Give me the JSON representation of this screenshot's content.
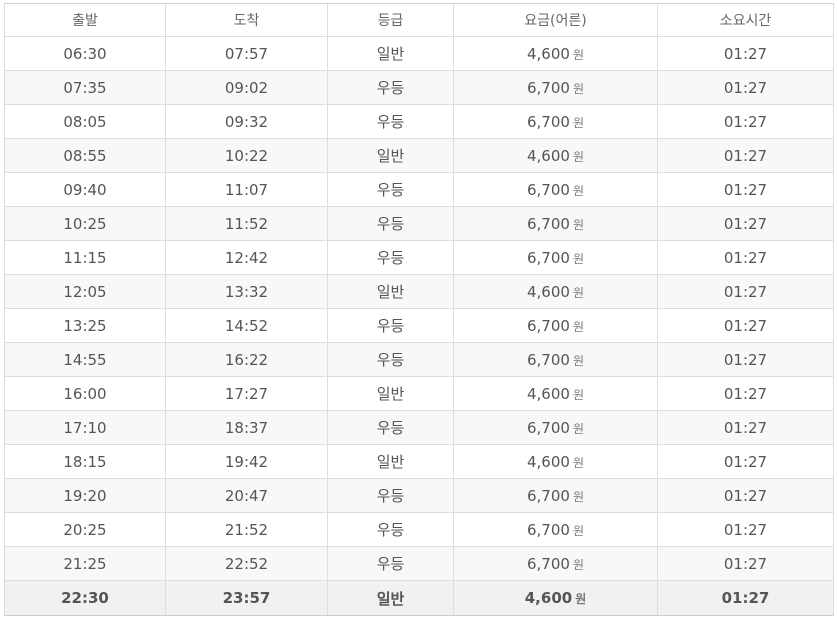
{
  "table": {
    "headers": [
      "출발",
      "도착",
      "등급",
      "요금(어른)",
      "소요시간"
    ],
    "currency_unit": "원",
    "rows": [
      {
        "depart": "06:30",
        "arrive": "07:57",
        "grade": "일반",
        "fare": "4,600",
        "duration": "01:27"
      },
      {
        "depart": "07:35",
        "arrive": "09:02",
        "grade": "우등",
        "fare": "6,700",
        "duration": "01:27"
      },
      {
        "depart": "08:05",
        "arrive": "09:32",
        "grade": "우등",
        "fare": "6,700",
        "duration": "01:27"
      },
      {
        "depart": "08:55",
        "arrive": "10:22",
        "grade": "일반",
        "fare": "4,600",
        "duration": "01:27"
      },
      {
        "depart": "09:40",
        "arrive": "11:07",
        "grade": "우등",
        "fare": "6,700",
        "duration": "01:27"
      },
      {
        "depart": "10:25",
        "arrive": "11:52",
        "grade": "우등",
        "fare": "6,700",
        "duration": "01:27"
      },
      {
        "depart": "11:15",
        "arrive": "12:42",
        "grade": "우등",
        "fare": "6,700",
        "duration": "01:27"
      },
      {
        "depart": "12:05",
        "arrive": "13:32",
        "grade": "일반",
        "fare": "4,600",
        "duration": "01:27"
      },
      {
        "depart": "13:25",
        "arrive": "14:52",
        "grade": "우등",
        "fare": "6,700",
        "duration": "01:27"
      },
      {
        "depart": "14:55",
        "arrive": "16:22",
        "grade": "우등",
        "fare": "6,700",
        "duration": "01:27"
      },
      {
        "depart": "16:00",
        "arrive": "17:27",
        "grade": "일반",
        "fare": "4,600",
        "duration": "01:27"
      },
      {
        "depart": "17:10",
        "arrive": "18:37",
        "grade": "우등",
        "fare": "6,700",
        "duration": "01:27"
      },
      {
        "depart": "18:15",
        "arrive": "19:42",
        "grade": "일반",
        "fare": "4,600",
        "duration": "01:27"
      },
      {
        "depart": "19:20",
        "arrive": "20:47",
        "grade": "우등",
        "fare": "6,700",
        "duration": "01:27"
      },
      {
        "depart": "20:25",
        "arrive": "21:52",
        "grade": "우등",
        "fare": "6,700",
        "duration": "01:27"
      },
      {
        "depart": "21:25",
        "arrive": "22:52",
        "grade": "우등",
        "fare": "6,700",
        "duration": "01:27"
      },
      {
        "depart": "22:30",
        "arrive": "23:57",
        "grade": "일반",
        "fare": "4,600",
        "duration": "01:27"
      }
    ]
  }
}
